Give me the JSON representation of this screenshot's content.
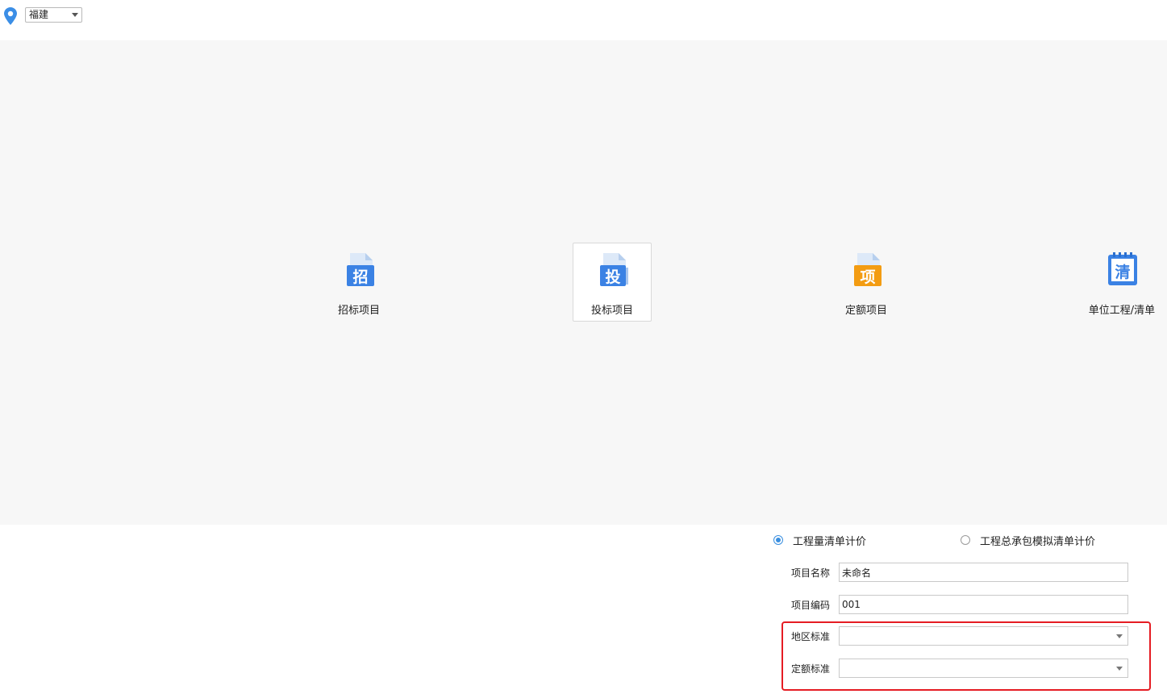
{
  "topbar": {
    "location_icon": "map-pin-icon",
    "region_select": {
      "value": "福建"
    }
  },
  "tiles": [
    {
      "label": "招标项目",
      "icon_char": "招",
      "icon": "bid-invite-file-icon",
      "color": "#3b82e4",
      "selected": false
    },
    {
      "label": "投标项目",
      "icon_char": "投",
      "icon": "bid-submit-file-icon",
      "color": "#3b82e4",
      "selected": true
    },
    {
      "label": "定额项目",
      "icon_char": "项",
      "icon": "quota-project-file-icon",
      "color": "#f39c12",
      "selected": false
    },
    {
      "label": "单位工程/清单",
      "icon_char": "清",
      "icon": "bill-notebook-icon",
      "color": "#3b82e4",
      "selected": false
    }
  ],
  "form": {
    "radio_a": {
      "label": "工程量清单计价",
      "checked": true
    },
    "radio_b": {
      "label": "工程总承包模拟清单计价",
      "checked": false
    },
    "project_name": {
      "label": "项目名称",
      "value": "未命名"
    },
    "project_code": {
      "label": "项目编码",
      "value": "001"
    },
    "region_standard": {
      "label": "地区标准",
      "value": ""
    },
    "quota_standard": {
      "label": "定额标准",
      "value": ""
    }
  },
  "colors": {
    "accent": "#3a8fe0",
    "highlight": "#e51c23",
    "orange": "#f39c12"
  }
}
